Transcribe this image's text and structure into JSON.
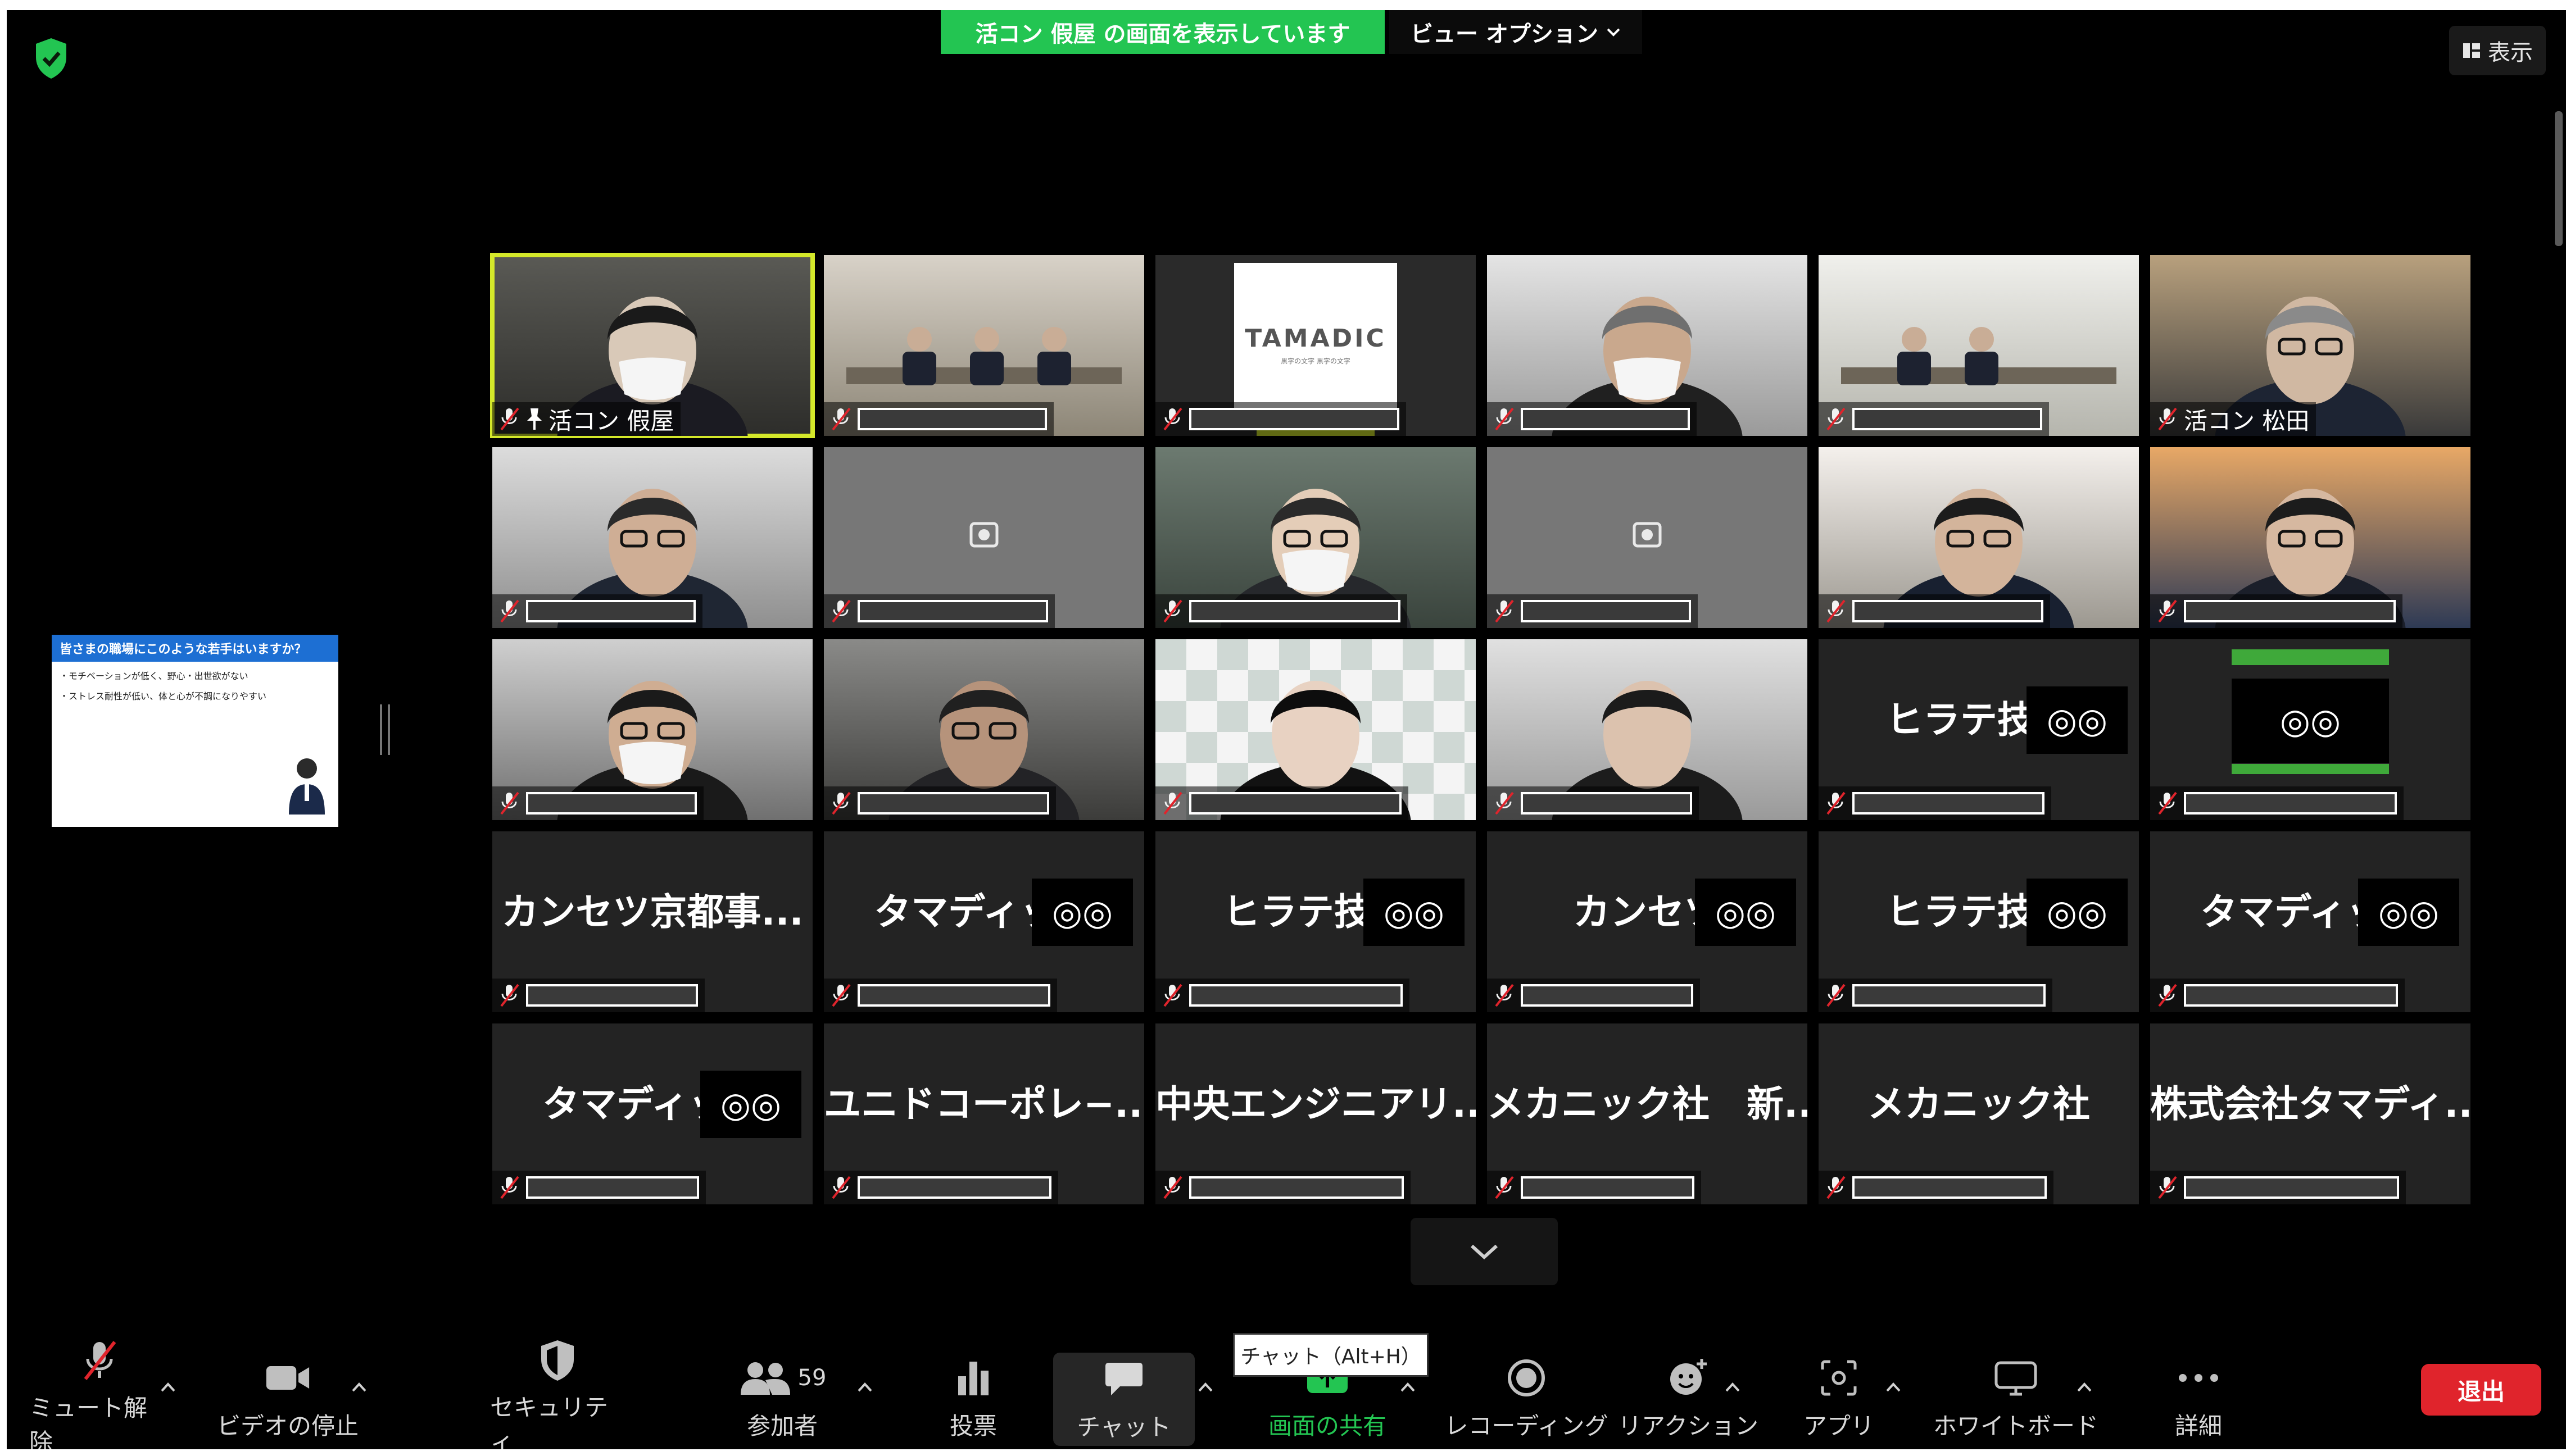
{
  "top_bar": {
    "share_banner": "活コン 假屋 の画面を表示しています",
    "view_options": "ビュー オプション",
    "view_button": "表示"
  },
  "slide": {
    "heading": "皆さまの職場にこのような若手はいますか？",
    "lines": [
      "・モチベーションが低く、野心・出世欲がない",
      "・ストレス耐性が低い、体と心が不調になりやすい"
    ]
  },
  "tiles": [
    {
      "label": "活コン 假屋",
      "pinned": true,
      "active": true
    },
    {
      "label": ""
    },
    {
      "label": "",
      "logo": "TAMADIC",
      "logo_sub": "黒字の文字 黒字の文字"
    },
    {
      "label": ""
    },
    {
      "label": ""
    },
    {
      "label": "活コン 松田"
    },
    {
      "label": ""
    },
    {
      "label": ""
    },
    {
      "label": ""
    },
    {
      "label": ""
    },
    {
      "label": ""
    },
    {
      "label": ""
    },
    {
      "label": ""
    },
    {
      "label": ""
    },
    {
      "label": ""
    },
    {
      "label": ""
    },
    {
      "label": "",
      "big_name": "ヒラテ技研",
      "overlay": "◎◎"
    },
    {
      "label": "",
      "overlay": "◎◎"
    },
    {
      "label": "",
      "big_name": "カンセツ京都事..."
    },
    {
      "label": "",
      "big_name": "タマディック",
      "overlay": "◎◎"
    },
    {
      "label": "",
      "big_name": "ヒラテ技研",
      "overlay": "◎◎"
    },
    {
      "label": "",
      "big_name": "カンセツ",
      "overlay": "◎◎"
    },
    {
      "label": "",
      "big_name": "ヒラテ技研",
      "overlay": "◎◎"
    },
    {
      "label": "",
      "big_name": "タマディック",
      "overlay": "◎◎"
    },
    {
      "label": "",
      "big_name": "タマディック",
      "overlay": "◎◎"
    },
    {
      "label": "",
      "big_name": "ユニドコーポレ−..."
    },
    {
      "label": "",
      "big_name": "中央エンジニアリ..."
    },
    {
      "label": "",
      "big_name": "メカニック社　新..."
    },
    {
      "label": "",
      "big_name": "メカニック社"
    },
    {
      "label": "",
      "big_name": "株式会社タマディ..."
    }
  ],
  "toolbar": {
    "unmute": "ミュート解除",
    "stop_video": "ビデオの停止",
    "security": "セキュリティ",
    "participants": "参加者",
    "participants_count": "59",
    "poll": "投票",
    "chat": "チャット",
    "share_screen": "画面の共有",
    "recording": "レコーディング",
    "reactions": "リアクション",
    "apps": "アプリ",
    "whiteboard": "ホワイトボード",
    "more": "詳細",
    "leave": "退出"
  },
  "tooltip": {
    "chat": "チャット（Alt+H）"
  },
  "colors": {
    "background": "#000000",
    "share_green": "#23c552",
    "leave_red": "#e0242c",
    "active_speaker": "#d4e82a",
    "tile": "#232323"
  }
}
